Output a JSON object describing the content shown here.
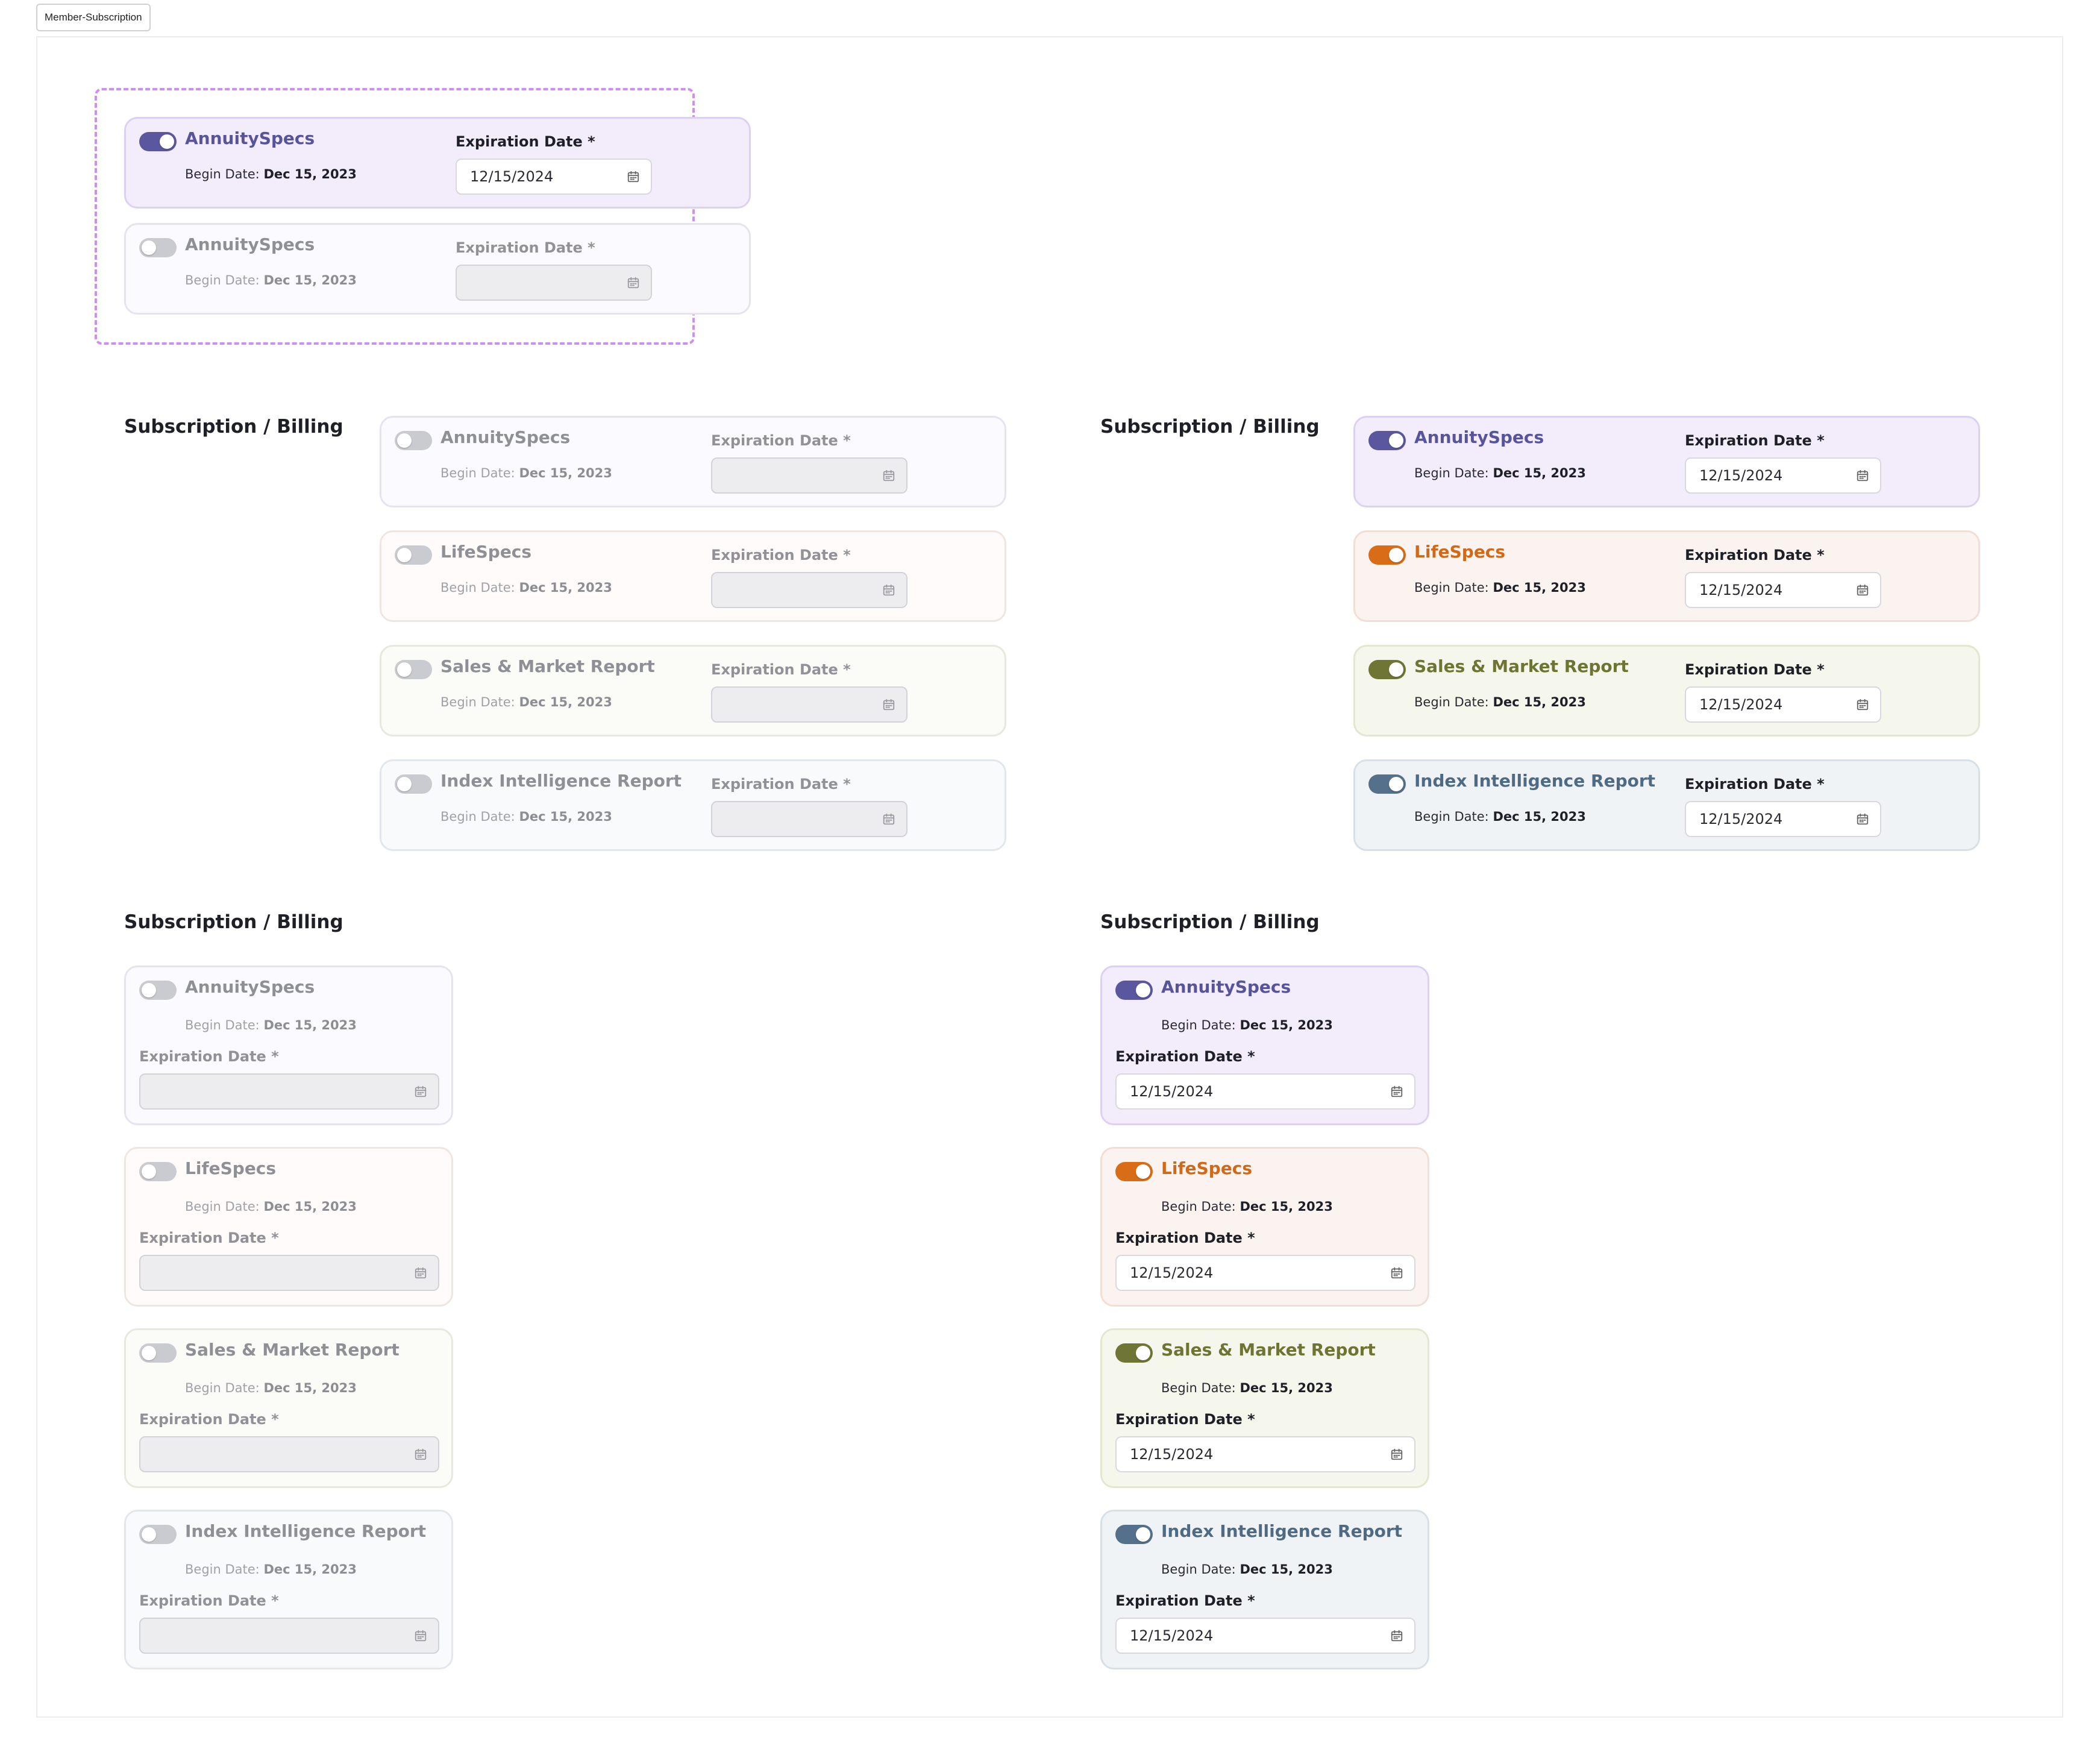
{
  "page_label": "Member-Subscription",
  "section_title": "Subscription / Billing",
  "products": [
    {
      "name": "AnnuitySpecs",
      "theme": "purple"
    },
    {
      "name": "LifeSpecs",
      "theme": "orange"
    },
    {
      "name": "Sales & Market Report",
      "theme": "olive"
    },
    {
      "name": "Index Intelligence Report",
      "theme": "slate"
    }
  ],
  "begin_label": "Begin Date:",
  "begin_value": "Dec 15, 2023",
  "expiration_label": "Expiration Date *",
  "expiration_value": "12/15/2024",
  "colors": {
    "purple": "#5b579e",
    "orange": "#d96c17",
    "olive": "#6f7535",
    "slate": "#55708a",
    "toggle_off": "#c9cbd0",
    "highlight_dash": "#cf8ff2"
  },
  "icons": {
    "toggle": "toggle-switch",
    "calendar": "calendar-icon"
  }
}
